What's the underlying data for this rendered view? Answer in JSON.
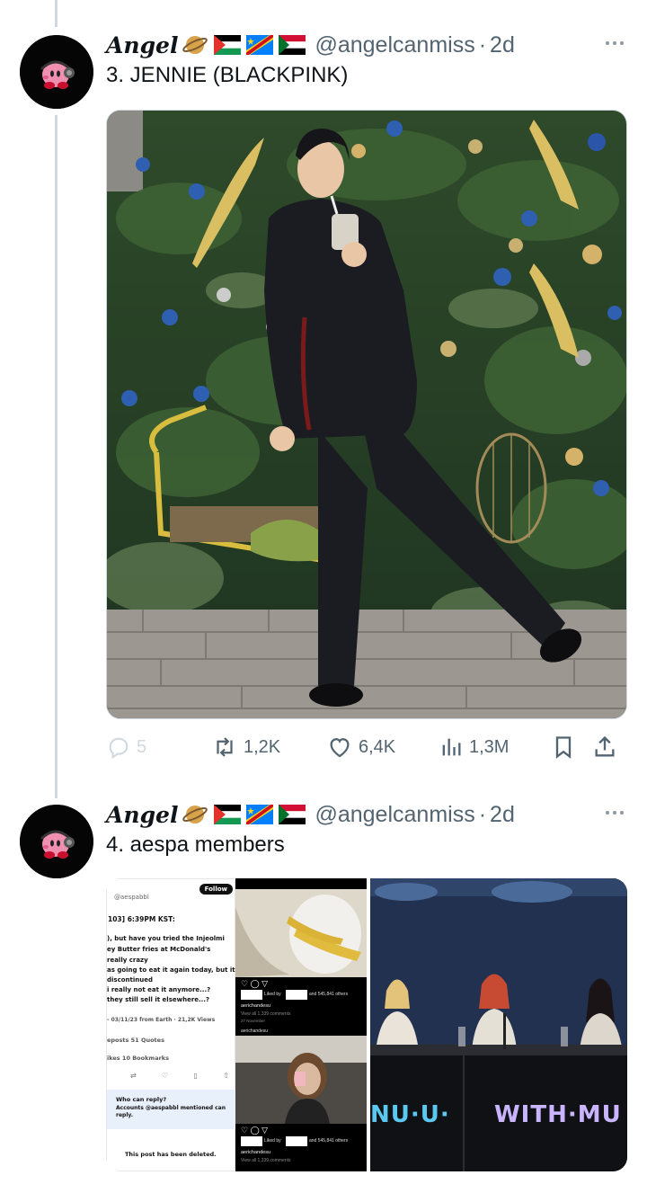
{
  "tweets": [
    {
      "name": "Angel",
      "handle": "@angelcanmiss",
      "time": "2d",
      "text": "3. JENNIE (BLACKPINK)",
      "stats": {
        "replies": "5",
        "reposts": "1,2K",
        "likes": "6,4K",
        "views": "1,3M"
      }
    },
    {
      "name": "Angel",
      "handle": "@angelcanmiss",
      "time": "2d",
      "text": "4. aespa members",
      "screenshot": {
        "follow": "Follow",
        "account": "@aespabbl",
        "date_line": "103] 6:39PM KST:",
        "lines": [
          "), but have you tried the Injeolmi",
          "ey Butter fries at McDonald's",
          "really crazy",
          "as going to eat it again today, but it",
          "discontinued",
          "i really not eat it anymore...?",
          "they still sell it elsewhere...?"
        ],
        "meta": "- 03/11/23 from Earth · 21,2K Views",
        "reposts": "eposts  51 Quotes",
        "likes": "ikes  10 Bookmarks",
        "reply_title": "Who can reply?",
        "reply_sub": "Accounts @aespabbl mentioned can reply.",
        "deleted": "This post has been deleted."
      },
      "insta": {
        "liked_by": "Liked by",
        "others": "and 545,841 others",
        "user": "aerichandesu",
        "comments": "View all 1,339 comments",
        "date": "27 November"
      },
      "stage": {
        "left_text": "NU·U·",
        "right_text": "WITH·MU"
      }
    }
  ],
  "colors": {
    "accent": "#1d9bf0",
    "muted": "#536471",
    "line": "#cfd9de"
  }
}
